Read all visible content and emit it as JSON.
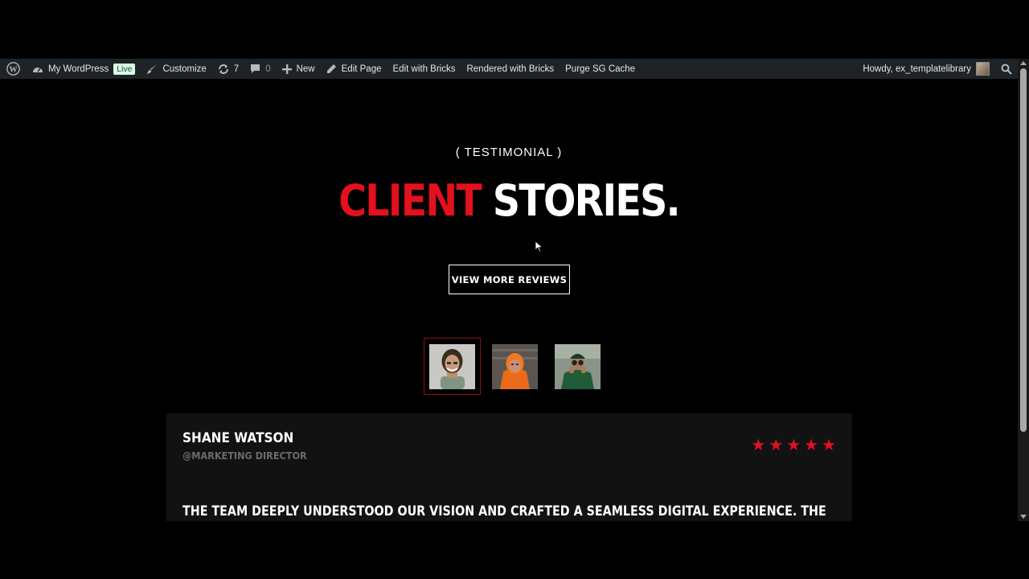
{
  "adminbar": {
    "site_name": "My WordPress",
    "live_badge": "Live",
    "customize": "Customize",
    "updates_count": "7",
    "comments_count": "0",
    "new": "New",
    "edit_page": "Edit Page",
    "edit_with_bricks": "Edit with Bricks",
    "rendered_with_bricks": "Rendered with Bricks",
    "purge_cache": "Purge SG Cache",
    "howdy": "Howdy, ex_templatelibrary"
  },
  "hero": {
    "eyebrow": "( TESTIMONIAL )",
    "title_red": "CLIENT",
    "title_white": "STORIES.",
    "button": "VIEW MORE REVIEWS"
  },
  "testimonial": {
    "name": "SHANE WATSON",
    "role": "@MARKETING DIRECTOR",
    "rating": 5,
    "quote": "THE TEAM DEEPLY UNDERSTOOD OUR VISION AND CRAFTED A SEAMLESS DIGITAL EXPERIENCE. THE"
  },
  "colors": {
    "accent": "#e3101d",
    "adminbar_bg": "#1d2327",
    "card_bg": "#121212"
  }
}
